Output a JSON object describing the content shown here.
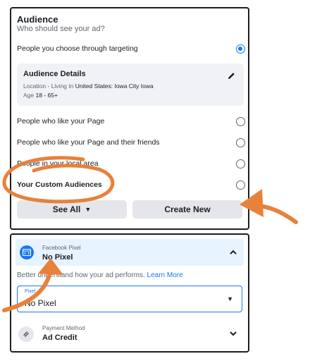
{
  "audience": {
    "title": "Audience",
    "subtitle": "Who should see your ad?",
    "options": [
      {
        "label": "People you choose through targeting",
        "selected": true
      },
      {
        "label": "People who like your Page",
        "selected": false
      },
      {
        "label": "People who like your Page and their friends",
        "selected": false
      },
      {
        "label": "People in your local area",
        "selected": false
      },
      {
        "label": "Your Custom Audiences",
        "selected": false
      }
    ],
    "details": {
      "title": "Audience Details",
      "location_prefix": "Location - Living In ",
      "location_value": "United States: Iowa City Iowa",
      "age_prefix": "Age ",
      "age_value": "18 - 65+",
      "edit_icon": "pencil-icon"
    },
    "see_all_label": "See All",
    "create_new_label": "Create New"
  },
  "pixel": {
    "small_label": "Facebook Pixel",
    "value": "No Pixel",
    "help_text": "Better understand how your ad performs. ",
    "learn_more": "Learn More",
    "select_label": "Pixel",
    "select_value": "No Pixel"
  },
  "payment": {
    "small_label": "Payment Method",
    "value": "Ad Credit"
  },
  "colors": {
    "accent": "#1877f2",
    "annotation": "#e8813a",
    "panel_bg": "#f0f2f5"
  }
}
